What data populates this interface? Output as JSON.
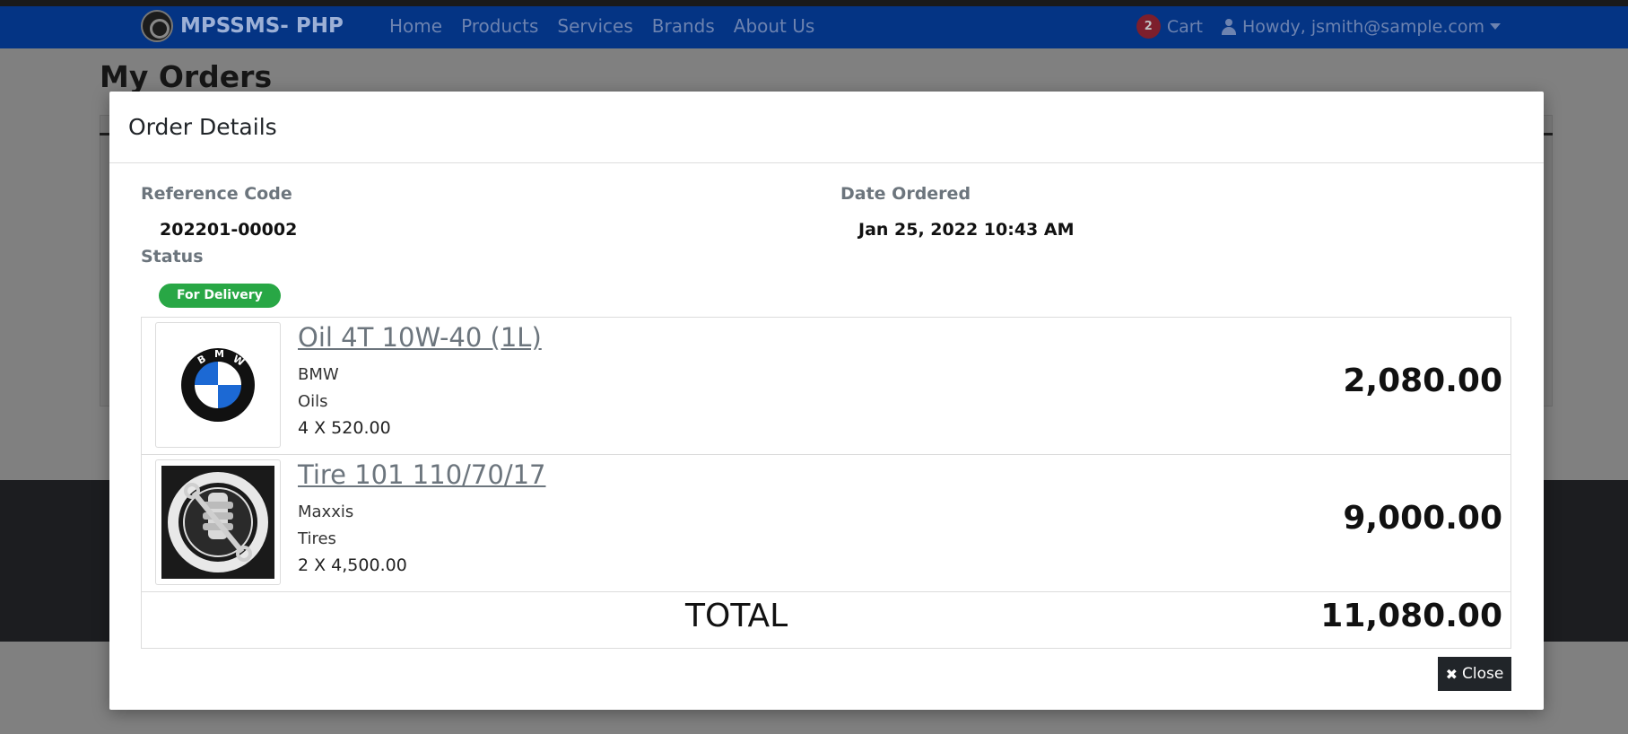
{
  "navbar": {
    "brand": "MPSSMS- PHP",
    "links": [
      "Home",
      "Products",
      "Services",
      "Brands",
      "About Us"
    ],
    "cart_count": "2",
    "cart_label": "Cart",
    "user_label": "Howdy, jsmith@sample.com"
  },
  "page": {
    "title": "My Orders"
  },
  "modal": {
    "title": "Order Details",
    "reference_label": "Reference Code",
    "reference_value": "202201-00002",
    "date_label": "Date Ordered",
    "date_value": "Jan 25, 2022 10:43 AM",
    "status_label": "Status",
    "status_value": "For Delivery",
    "items": [
      {
        "name": "Oil 4T 10W-40 (1L)",
        "brand": "BMW",
        "category": "Oils",
        "qty_price": "4 X 520.00",
        "total": "2,080.00",
        "image_icon": "bmw-logo-icon"
      },
      {
        "name": "Tire 101 110/70/17",
        "brand": "Maxxis",
        "category": "Tires",
        "qty_price": "2 X 4,500.00",
        "total": "9,000.00",
        "image_icon": "motorcycle-build-repair-logo-icon"
      }
    ],
    "total_label": "TOTAL",
    "total_value": "11,080.00",
    "close_label": "Close",
    "colors": {
      "navbar": "#043484",
      "status_badge": "#28a745",
      "close_button": "#212529"
    }
  }
}
